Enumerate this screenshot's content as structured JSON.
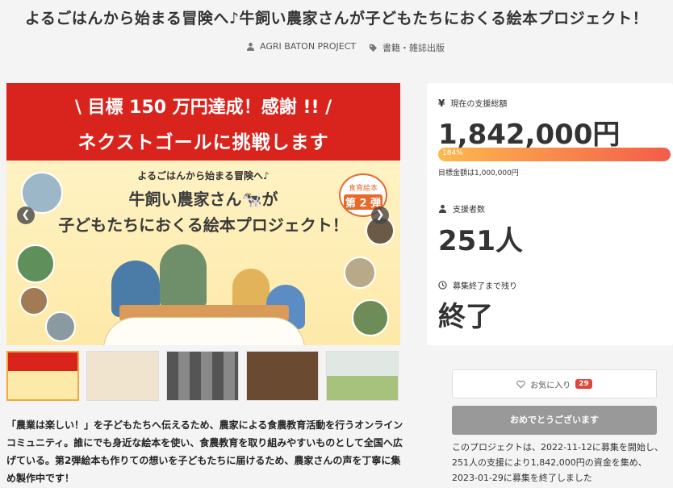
{
  "project": {
    "title": "よるごはんから始まる冒険へ♪牛飼い農家さんが子どもたちにおくる絵本プロジェクト！",
    "owner": "AGRI BATON PROJECT",
    "category": "書籍・雑誌出版"
  },
  "hero": {
    "banner_line1": "\\ 目標 150 万円達成！感謝 !! /",
    "banner_line2": "ネクストゴールに挑戦します",
    "subtitle": "よるごはんから始まる冒険へ♪",
    "title_line1": "牛飼い農家さん🐄が",
    "title_line2": "子どもたちにおくる絵本プロジェクト！",
    "badge_top": "食育絵本",
    "badge_bottom": "第 2 弾",
    "prev_arrow": "❮",
    "next_arrow": "❯"
  },
  "description": "「農業は楽しい！」を子どもたちへ伝えるため、農家による食農教育活動を行うオンラインコミュニティ。誰にでも身近な絵本を使い、食農教育を取り組みやすいものとして全国へ広げている。第2弾絵本も作りての想いを子どもたちに届けるため、農家さんの声を丁寧に集め製作中です！",
  "stats": {
    "total_label": "現在の支援総額",
    "total_value": "1,842,000円",
    "percent_label": "184%",
    "percent_value": 184,
    "goal_text": "目標金額は1,000,000円",
    "backers_label": "支援者数",
    "backers_value": "251人",
    "remaining_label": "募集終了まで残り",
    "remaining_value": "終了"
  },
  "actions": {
    "favorite_label": "お気に入り",
    "favorite_count": "29",
    "congrats_label": "おめでとうございます"
  },
  "summary": "このプロジェクトは、2022-11-12に募集を開始し、251人の支援により1,842,000円の資金を集め、2023-01-29に募集を終了しました",
  "colors": {
    "banner": "#d9231d",
    "bar_start": "#ffb84d",
    "bar_end": "#f35d4a",
    "fav_count": "#e0453a"
  }
}
